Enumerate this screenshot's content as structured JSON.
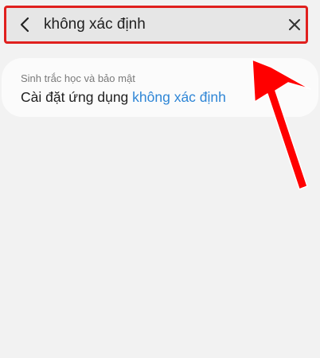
{
  "search": {
    "query": "không xác định",
    "back_icon": "back-arrow-icon",
    "clear_icon": "close-icon"
  },
  "results": [
    {
      "category": "Sinh trắc học và bảo mật",
      "title_prefix": "Cài đặt ứng dụng ",
      "title_match": "không xác định"
    }
  ],
  "colors": {
    "background": "#f2f2f2",
    "search_bar": "#e6e6e6",
    "highlight": "#2f86d6",
    "annotation": "#e0201e",
    "card": "#fbfbfb"
  }
}
